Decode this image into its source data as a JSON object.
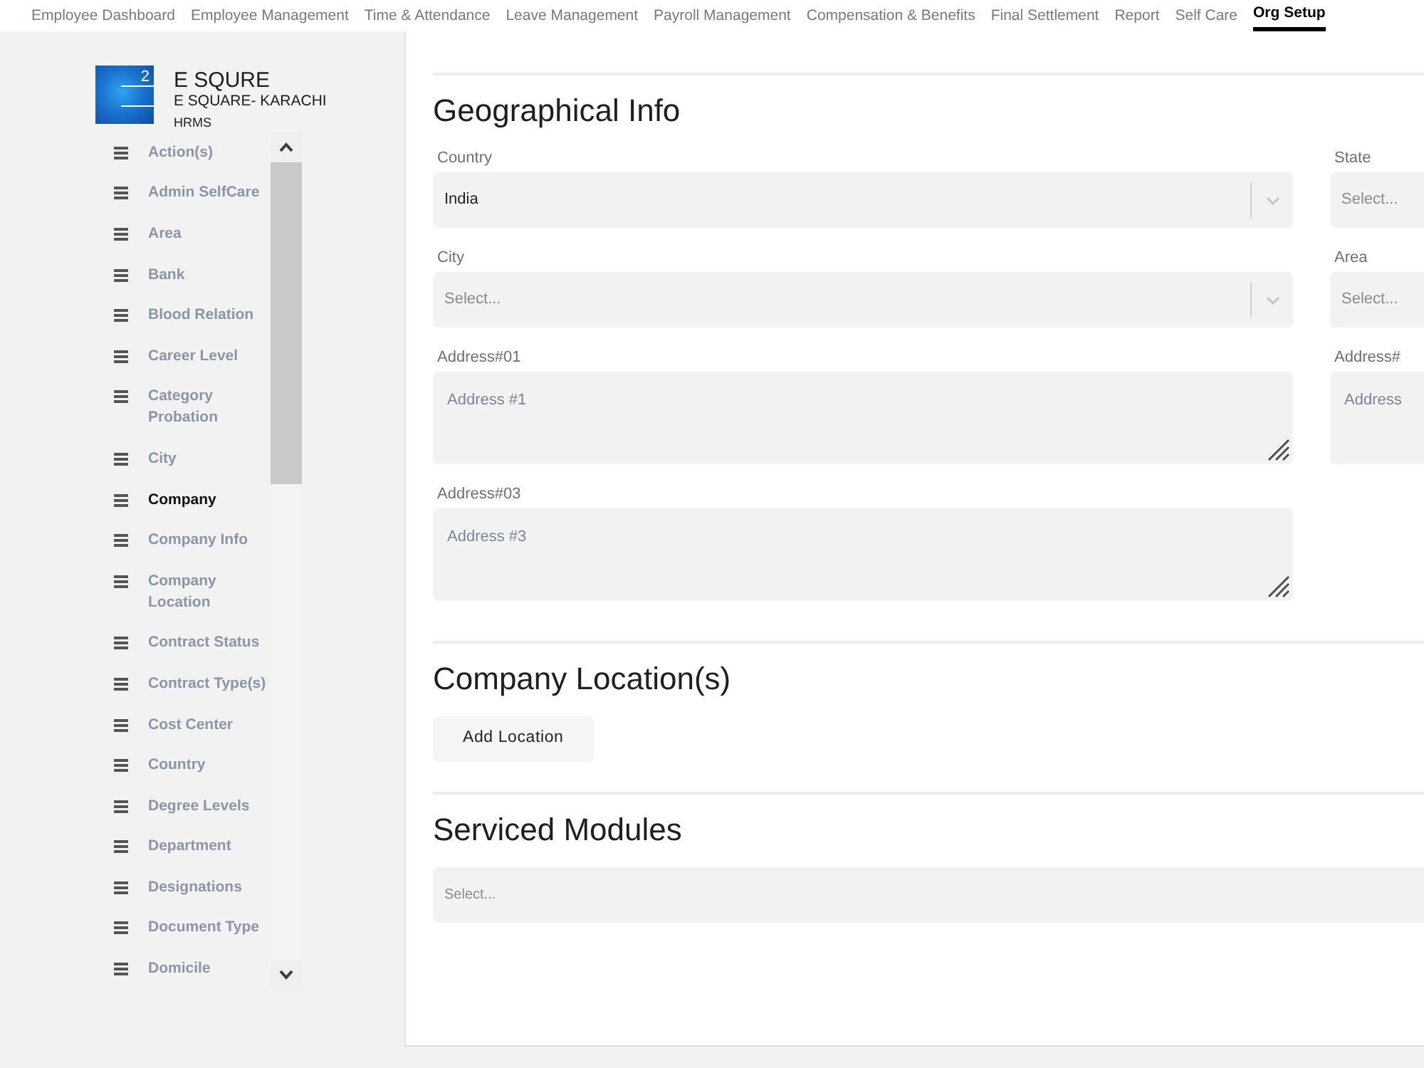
{
  "top_nav": {
    "items": [
      {
        "label": "Employee Dashboard",
        "selected": false
      },
      {
        "label": "Employee Management",
        "selected": false
      },
      {
        "label": "Time & Attendance",
        "selected": false
      },
      {
        "label": "Leave Management",
        "selected": false
      },
      {
        "label": "Payroll Management",
        "selected": false
      },
      {
        "label": "Compensation & Benefits",
        "selected": false
      },
      {
        "label": "Final Settlement",
        "selected": false
      },
      {
        "label": "Report",
        "selected": false
      },
      {
        "label": "Self Care",
        "selected": false
      },
      {
        "label": "Org Setup",
        "selected": true
      }
    ]
  },
  "sidebar": {
    "logo": {
      "mark": "2"
    },
    "company_name": "E SQURE",
    "branch": "E SQUARE- KARACHI",
    "product": "HRMS",
    "items": [
      {
        "label": "Action(s)",
        "selected": false
      },
      {
        "label": "Admin SelfCare",
        "selected": false
      },
      {
        "label": "Area",
        "selected": false
      },
      {
        "label": "Bank",
        "selected": false
      },
      {
        "label": "Blood Relation",
        "selected": false
      },
      {
        "label": "Career Level",
        "selected": false
      },
      {
        "label": "Category Probation",
        "selected": false
      },
      {
        "label": "City",
        "selected": false
      },
      {
        "label": "Company",
        "selected": true
      },
      {
        "label": "Company Info",
        "selected": false
      },
      {
        "label": "Company Location",
        "selected": false
      },
      {
        "label": "Contract Status",
        "selected": false
      },
      {
        "label": "Contract Type(s)",
        "selected": false
      },
      {
        "label": "Cost Center",
        "selected": false
      },
      {
        "label": "Country",
        "selected": false
      },
      {
        "label": "Degree Levels",
        "selected": false
      },
      {
        "label": "Department",
        "selected": false
      },
      {
        "label": "Designations",
        "selected": false
      },
      {
        "label": "Document Type",
        "selected": false
      },
      {
        "label": "Domicile",
        "selected": false
      }
    ]
  },
  "sections": [
    {
      "kind": "form",
      "title": "Geographical Info",
      "rows": [
        [
          {
            "kind": "select",
            "label": "Country",
            "value": "India",
            "dropdown_arrow": true
          },
          {
            "kind": "select",
            "label": "State",
            "placeholder": "Select...",
            "dropdown_arrow": false
          }
        ],
        [
          {
            "kind": "select",
            "label": "City",
            "placeholder": "Select...",
            "dropdown_arrow": true
          },
          {
            "kind": "select",
            "label": "Area",
            "placeholder": "Select...",
            "dropdown_arrow": false
          }
        ],
        [
          {
            "kind": "textarea",
            "label": "Address#01",
            "placeholder": "Address #1",
            "resize_handle": true
          },
          {
            "kind": "textarea",
            "label": "Address#",
            "placeholder": "Address",
            "resize_handle": false
          }
        ],
        [
          {
            "kind": "textarea",
            "label": "Address#03",
            "placeholder": "Address #3",
            "resize_handle": true
          }
        ]
      ]
    },
    {
      "kind": "actions",
      "title": "Company Location(s)",
      "buttons": [
        "Add Location"
      ]
    },
    {
      "kind": "select",
      "title": "Serviced Modules",
      "field": {
        "placeholder": "Select...",
        "dropdown_arrow": false
      }
    }
  ]
}
